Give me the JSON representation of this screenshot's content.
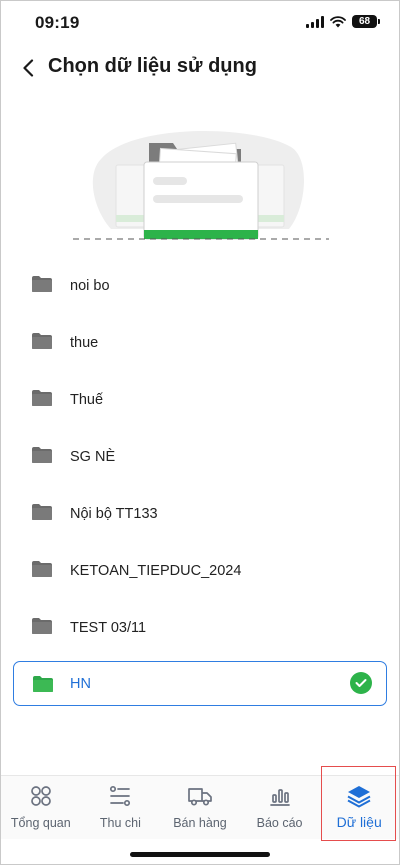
{
  "status_bar": {
    "time": "09:19",
    "battery": "68"
  },
  "header": {
    "title": "Chọn dữ liệu sử dụng"
  },
  "folders": [
    {
      "name": "noi bo"
    },
    {
      "name": "thue"
    },
    {
      "name": "Thuế"
    },
    {
      "name": "SG NÈ"
    },
    {
      "name": "Nội bộ TT133"
    },
    {
      "name": "KETOAN_TIEPDUC_2024"
    },
    {
      "name": "TEST 03/11"
    },
    {
      "name": "HN",
      "selected": true
    }
  ],
  "bottom_nav": [
    {
      "label": "Tổng quan",
      "icon": "grid-icon"
    },
    {
      "label": "Thu chi",
      "icon": "list-icon"
    },
    {
      "label": "Bán hàng",
      "icon": "truck-icon"
    },
    {
      "label": "Báo cáo",
      "icon": "chart-icon"
    },
    {
      "label": "Dữ liệu",
      "icon": "layers-icon",
      "active": true
    }
  ],
  "colors": {
    "accent": "#1f6fd6",
    "selected_border": "#2f7de1",
    "check_green": "#2db34a",
    "folder_gray": "#6b6b6b",
    "folder_green": "#3cb954",
    "highlight_red": "#e54d4d"
  }
}
